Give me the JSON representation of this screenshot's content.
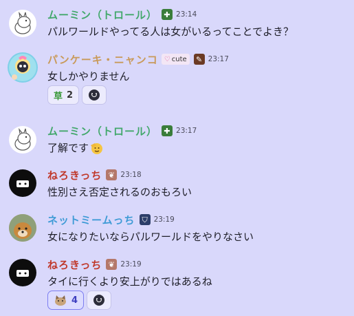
{
  "messages": [
    {
      "author": "ムーミン（トロール）",
      "author_color": "#43a86c",
      "role_icon": "green-plus-role-icon",
      "time": "23:14",
      "text": "パルワールドやってる人は女がいるってことでよき？"
    },
    {
      "author": "パンケーキ・ニャンコ",
      "author_color": "#c99a5a",
      "tag": "cute",
      "role_icon": "brown-item-role-icon",
      "time": "23:17",
      "text": "女しかやりません",
      "reactions": [
        {
          "emoji": "草",
          "count": "2"
        }
      ]
    },
    {
      "author": "ムーミン（トロール）",
      "author_color": "#43a86c",
      "role_icon": "green-plus-role-icon",
      "time": "23:17",
      "text": "了解です"
    },
    {
      "author": "ねろきっち",
      "author_color": "#c0392b",
      "role_icon": "pink-role-icon",
      "time": "23:18",
      "text": "性別さえ否定されるのおもろい"
    },
    {
      "author": "ネットミームっち",
      "author_color": "#3f9bd6",
      "role_icon": "shield-role-icon",
      "time": "23:19",
      "text": "女になりたいならパルワールドをやりなさい"
    },
    {
      "author": "ねろきっち",
      "author_color": "#c0392b",
      "role_icon": "pink-role-icon",
      "time": "23:19",
      "text": "タイに行くより安上がりではあるね",
      "reactions": [
        {
          "emoji": "cat-emoji",
          "count": "4"
        }
      ]
    }
  ]
}
